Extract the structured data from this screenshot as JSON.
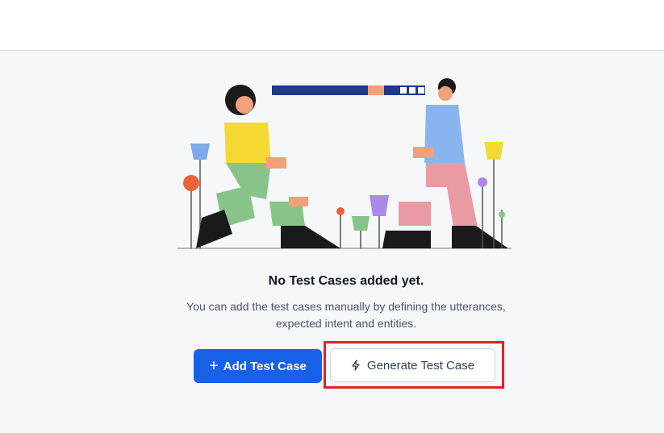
{
  "empty_state": {
    "title": "No Test Cases added yet.",
    "description_line1": "You can add the test cases manually by defining the utterances,",
    "description_line2": "expected intent and entities."
  },
  "actions": {
    "add_label": "Add Test Case",
    "add_icon": "plus-icon",
    "generate_label": "Generate Test Case",
    "generate_icon": "lightning-icon"
  },
  "colors": {
    "primary": "#1760e8",
    "highlight": "#e0222b"
  }
}
